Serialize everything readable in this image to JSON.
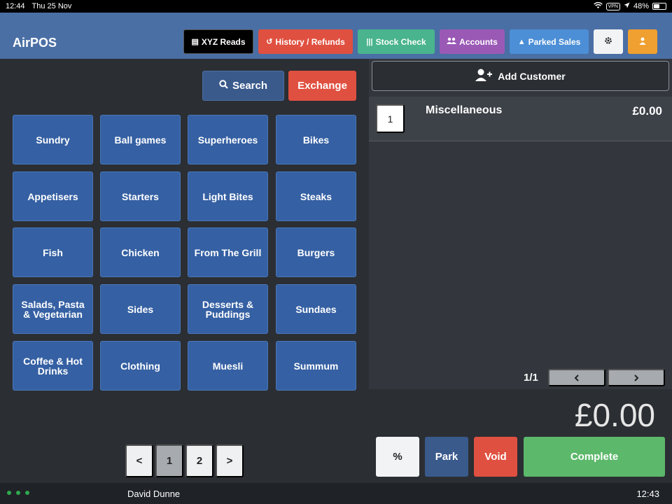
{
  "status": {
    "time": "12:44",
    "date": "Thu 25 Nov",
    "vpn": "VPN",
    "battery": "48%",
    "battery_level": 0.48
  },
  "app": {
    "title": "AirPOS"
  },
  "toolbar": {
    "xyz_reads": "XYZ Reads",
    "history_refunds": "History / Refunds",
    "stock_check": "Stock Check",
    "accounts": "Accounts",
    "parked_sales": "Parked Sales"
  },
  "actions": {
    "search": "Search",
    "exchange": "Exchange"
  },
  "categories": [
    "Sundry",
    "Ball games",
    "Superheroes",
    "Bikes",
    "Appetisers",
    "Starters",
    "Light Bites",
    "Steaks",
    "Fish",
    "Chicken",
    "From The Grill",
    "Burgers",
    "Salads, Pasta & Vegetarian",
    "Sides",
    "Desserts & Puddings",
    "Sundaes",
    "Coffee & Hot Drinks",
    "Clothing",
    "Muesli",
    "Summum"
  ],
  "pagination": {
    "prev": "<",
    "pages": [
      "1",
      "2"
    ],
    "next": ">"
  },
  "sale": {
    "add_customer": "Add Customer",
    "items": [
      {
        "qty": "1",
        "name": "Miscellaneous",
        "price": "£0.00"
      }
    ],
    "page_info": "1/1",
    "total": "£0.00",
    "discount": "%",
    "park": "Park",
    "void": "Void",
    "complete": "Complete"
  },
  "footer": {
    "user": "David Dunne",
    "time": "12:43"
  },
  "colors": {
    "header": "#4a6fa5",
    "category": "#3560a3",
    "danger": "#e05040",
    "success": "#5cb86a",
    "accounts": "#9b59b6",
    "parked": "#4c8fd6",
    "stock": "#49b48e",
    "user": "#f0a030"
  }
}
